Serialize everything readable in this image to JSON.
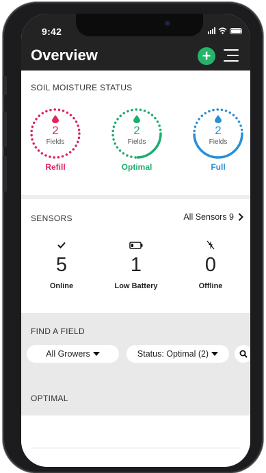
{
  "status_bar": {
    "time": "9:42"
  },
  "header": {
    "title": "Overview"
  },
  "soil": {
    "section_title": "SOIL MOISTURE STATUS",
    "gauges": [
      {
        "count": "2",
        "unit": "Fields",
        "label": "Refill",
        "color": "#e0245e"
      },
      {
        "count": "2",
        "unit": "Fields",
        "label": "Optimal",
        "color": "#1fad6f"
      },
      {
        "count": "2",
        "unit": "Fields",
        "label": "Full",
        "color": "#2a8fd6"
      }
    ]
  },
  "sensors": {
    "section_title": "SENSORS",
    "all_link": "All Sensors 9",
    "items": [
      {
        "icon": "check-icon",
        "count": "5",
        "label": "Online"
      },
      {
        "icon": "battery-low-icon",
        "count": "1",
        "label": "Low Battery"
      },
      {
        "icon": "no-power-icon",
        "count": "0",
        "label": "Offline"
      }
    ]
  },
  "find_field": {
    "section_title": "FIND A FIELD",
    "growers_filter": "All Growers",
    "status_filter": "Status: Optimal (2)",
    "search_icon": "search-icon"
  },
  "list": {
    "section_title": "OPTIMAL"
  }
}
